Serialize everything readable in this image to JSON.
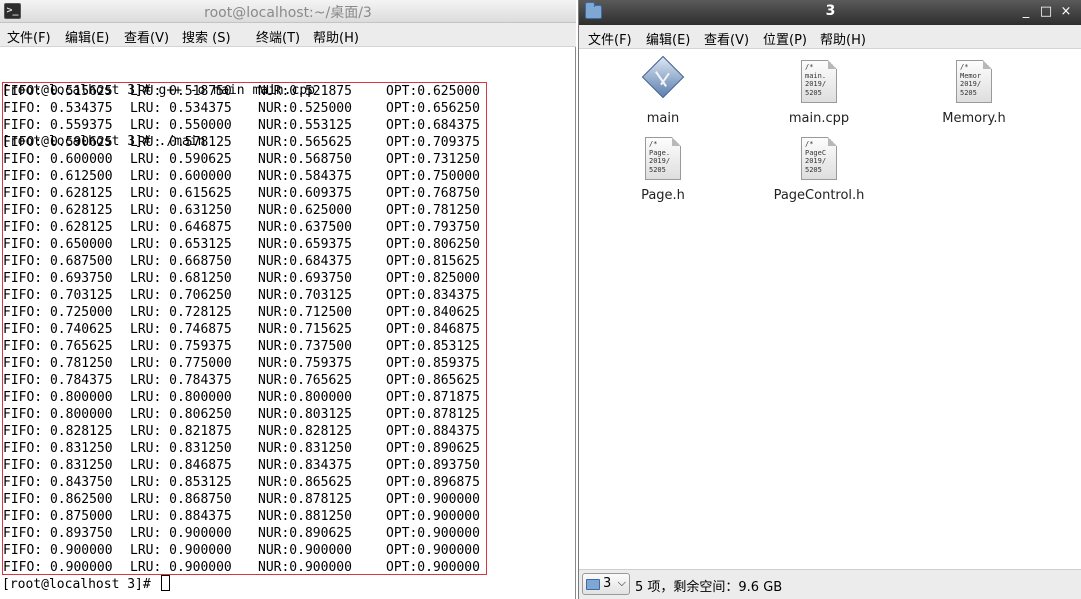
{
  "terminal": {
    "title": "root@localhost:~/桌面/3",
    "menu": [
      "文件(F)",
      "编辑(E)",
      "查看(V)",
      "搜索 (S)",
      "终端(T)",
      "帮助(H)"
    ],
    "lines": [
      "[root@localhost 3]# g++ -o main main.cpp",
      "[root@localhost 3]# ./main"
    ],
    "results": [
      [
        "FIFO: 0.515625",
        "LRU: 0.518750",
        "NUR:0.521875",
        "OPT:0.625000"
      ],
      [
        "FIFO: 0.534375",
        "LRU: 0.534375",
        "NUR:0.525000",
        "OPT:0.656250"
      ],
      [
        "FIFO: 0.559375",
        "LRU: 0.550000",
        "NUR:0.553125",
        "OPT:0.684375"
      ],
      [
        "FIFO: 0.590625",
        "LRU: 0.578125",
        "NUR:0.565625",
        "OPT:0.709375"
      ],
      [
        "FIFO: 0.600000",
        "LRU: 0.590625",
        "NUR:0.568750",
        "OPT:0.731250"
      ],
      [
        "FIFO: 0.612500",
        "LRU: 0.600000",
        "NUR:0.584375",
        "OPT:0.750000"
      ],
      [
        "FIFO: 0.628125",
        "LRU: 0.615625",
        "NUR:0.609375",
        "OPT:0.768750"
      ],
      [
        "FIFO: 0.628125",
        "LRU: 0.631250",
        "NUR:0.625000",
        "OPT:0.781250"
      ],
      [
        "FIFO: 0.628125",
        "LRU: 0.646875",
        "NUR:0.637500",
        "OPT:0.793750"
      ],
      [
        "FIFO: 0.650000",
        "LRU: 0.653125",
        "NUR:0.659375",
        "OPT:0.806250"
      ],
      [
        "FIFO: 0.687500",
        "LRU: 0.668750",
        "NUR:0.684375",
        "OPT:0.815625"
      ],
      [
        "FIFO: 0.693750",
        "LRU: 0.681250",
        "NUR:0.693750",
        "OPT:0.825000"
      ],
      [
        "FIFO: 0.703125",
        "LRU: 0.706250",
        "NUR:0.703125",
        "OPT:0.834375"
      ],
      [
        "FIFO: 0.725000",
        "LRU: 0.728125",
        "NUR:0.712500",
        "OPT:0.840625"
      ],
      [
        "FIFO: 0.740625",
        "LRU: 0.746875",
        "NUR:0.715625",
        "OPT:0.846875"
      ],
      [
        "FIFO: 0.765625",
        "LRU: 0.759375",
        "NUR:0.737500",
        "OPT:0.853125"
      ],
      [
        "FIFO: 0.781250",
        "LRU: 0.775000",
        "NUR:0.759375",
        "OPT:0.859375"
      ],
      [
        "FIFO: 0.784375",
        "LRU: 0.784375",
        "NUR:0.765625",
        "OPT:0.865625"
      ],
      [
        "FIFO: 0.800000",
        "LRU: 0.800000",
        "NUR:0.800000",
        "OPT:0.871875"
      ],
      [
        "FIFO: 0.800000",
        "LRU: 0.806250",
        "NUR:0.803125",
        "OPT:0.878125"
      ],
      [
        "FIFO: 0.828125",
        "LRU: 0.821875",
        "NUR:0.828125",
        "OPT:0.884375"
      ],
      [
        "FIFO: 0.831250",
        "LRU: 0.831250",
        "NUR:0.831250",
        "OPT:0.890625"
      ],
      [
        "FIFO: 0.831250",
        "LRU: 0.846875",
        "NUR:0.834375",
        "OPT:0.893750"
      ],
      [
        "FIFO: 0.843750",
        "LRU: 0.853125",
        "NUR:0.865625",
        "OPT:0.896875"
      ],
      [
        "FIFO: 0.862500",
        "LRU: 0.868750",
        "NUR:0.878125",
        "OPT:0.900000"
      ],
      [
        "FIFO: 0.875000",
        "LRU: 0.884375",
        "NUR:0.881250",
        "OPT:0.900000"
      ],
      [
        "FIFO: 0.893750",
        "LRU: 0.900000",
        "NUR:0.890625",
        "OPT:0.900000"
      ],
      [
        "FIFO: 0.900000",
        "LRU: 0.900000",
        "NUR:0.900000",
        "OPT:0.900000"
      ],
      [
        "FIFO: 0.900000",
        "LRU: 0.900000",
        "NUR:0.900000",
        "OPT:0.900000"
      ]
    ],
    "final_prompt": "[root@localhost 3]# ",
    "highlight_color": "#d9363e"
  },
  "file_manager": {
    "title": "3",
    "window_controls": [
      "_",
      "□",
      "×"
    ],
    "menu": [
      "文件(F)",
      "编辑(E)",
      "查看(V)",
      "位置(P)",
      "帮助(H)"
    ],
    "files": [
      {
        "name": "main",
        "icon": "executable-icon",
        "peek": ""
      },
      {
        "name": "main.cpp",
        "icon": "text-file-icon",
        "peek": "/*\nmain.\n2019/\n5​205"
      },
      {
        "name": "Memory.h",
        "icon": "text-file-icon",
        "peek": "/*\nMemor\n2019/\n5​205"
      },
      {
        "name": "Page.h",
        "icon": "text-file-icon",
        "peek": "/*\nPage.\n2019/\n5​205"
      },
      {
        "name": "PageControl.h",
        "icon": "text-file-icon",
        "peek": "/*\nPageC\n2019/\n5​205"
      }
    ],
    "status": {
      "location": "3",
      "text": "5 项，剩余空间：9.6 GB"
    }
  }
}
